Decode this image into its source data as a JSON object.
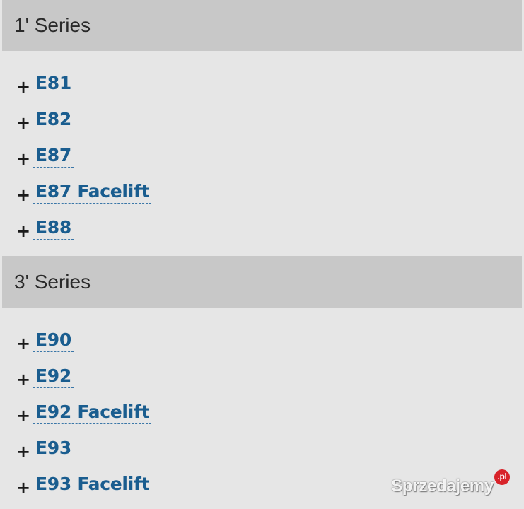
{
  "sections": [
    {
      "title": "1' Series",
      "items": [
        {
          "label": "E81"
        },
        {
          "label": "E82"
        },
        {
          "label": "E87"
        },
        {
          "label": "E87 Facelift"
        },
        {
          "label": "E88"
        }
      ]
    },
    {
      "title": "3' Series",
      "items": [
        {
          "label": "E90"
        },
        {
          "label": "E92"
        },
        {
          "label": "E92 Facelift"
        },
        {
          "label": "E93"
        },
        {
          "label": "E93 Facelift"
        }
      ]
    }
  ],
  "bullet_symbol": "+",
  "watermark": {
    "text": "Sprzedajemy",
    "badge": ".pl"
  },
  "colors": {
    "header_bg": "#c8c8c8",
    "page_bg": "#e6e6e6",
    "link": "#1a5d8f",
    "watermark_badge": "#d8232a"
  }
}
